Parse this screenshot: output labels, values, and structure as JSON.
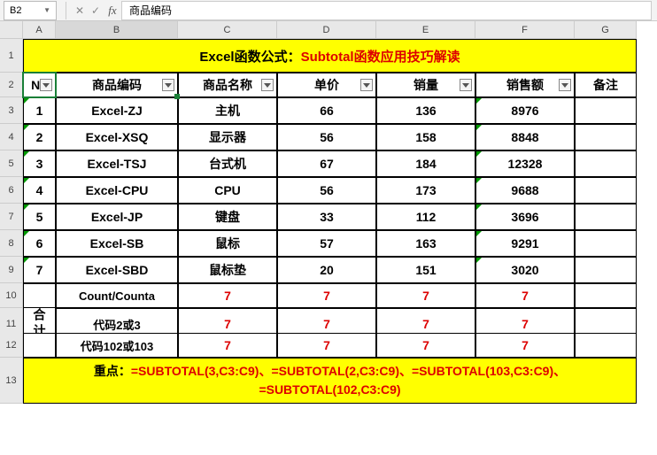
{
  "nameBox": "B2",
  "formulaContent": "商品编码",
  "colHeaders": [
    "A",
    "B",
    "C",
    "D",
    "E",
    "F",
    "G"
  ],
  "rowHeaders": [
    "1",
    "2",
    "3",
    "4",
    "5",
    "6",
    "7",
    "8",
    "9",
    "10",
    "11",
    "12",
    "13"
  ],
  "title": {
    "black": "Excel函数公式：",
    "red": "Subtotal函数应用技巧解读"
  },
  "headers": {
    "no": "No",
    "b": "商品编码",
    "c": "商品名称",
    "d": "单价",
    "e": "销量",
    "f": "销售额",
    "g": "备注"
  },
  "rows": [
    {
      "no": "1",
      "b": "Excel-ZJ",
      "c": "主机",
      "d": "66",
      "e": "136",
      "f": "8976"
    },
    {
      "no": "2",
      "b": "Excel-XSQ",
      "c": "显示器",
      "d": "56",
      "e": "158",
      "f": "8848"
    },
    {
      "no": "3",
      "b": "Excel-TSJ",
      "c": "台式机",
      "d": "67",
      "e": "184",
      "f": "12328"
    },
    {
      "no": "4",
      "b": "Excel-CPU",
      "c": "CPU",
      "d": "56",
      "e": "173",
      "f": "9688"
    },
    {
      "no": "5",
      "b": "Excel-JP",
      "c": "键盘",
      "d": "33",
      "e": "112",
      "f": "3696"
    },
    {
      "no": "6",
      "b": "Excel-SB",
      "c": "鼠标",
      "d": "57",
      "e": "163",
      "f": "9291"
    },
    {
      "no": "7",
      "b": "Excel-SBD",
      "c": "鼠标垫",
      "d": "20",
      "e": "151",
      "f": "3020"
    }
  ],
  "summary": {
    "mergeLabel": "合计",
    "rows": [
      {
        "b": "Count/Counta",
        "c": "7",
        "d": "7",
        "e": "7",
        "f": "7"
      },
      {
        "b": "代码2或3",
        "c": "7",
        "d": "7",
        "e": "7",
        "f": "7"
      },
      {
        "b": "代码102或103",
        "c": "7",
        "d": "7",
        "e": "7",
        "f": "7"
      }
    ]
  },
  "footer": {
    "label": "重点：",
    "f1": "=SUBTOTAL(3,C3:C9)",
    "s": "、",
    "f2": "=SUBTOTAL(2,C3:C9)",
    "f3": "=SUBTOTAL(103,C3:C9)",
    "f4": "=SUBTOTAL(102,C3:C9)"
  },
  "chart_data": {
    "type": "table",
    "title": "Excel函数公式：Subtotal函数应用技巧解读",
    "columns": [
      "No",
      "商品编码",
      "商品名称",
      "单价",
      "销量",
      "销售额",
      "备注"
    ],
    "rows": [
      [
        1,
        "Excel-ZJ",
        "主机",
        66,
        136,
        8976,
        ""
      ],
      [
        2,
        "Excel-XSQ",
        "显示器",
        56,
        158,
        8848,
        ""
      ],
      [
        3,
        "Excel-TSJ",
        "台式机",
        67,
        184,
        12328,
        ""
      ],
      [
        4,
        "Excel-CPU",
        "CPU",
        56,
        173,
        9688,
        ""
      ],
      [
        5,
        "Excel-JP",
        "键盘",
        33,
        112,
        3696,
        ""
      ],
      [
        6,
        "Excel-SB",
        "鼠标",
        57,
        163,
        9291,
        ""
      ],
      [
        7,
        "Excel-SBD",
        "鼠标垫",
        20,
        151,
        3020,
        ""
      ]
    ],
    "summary": [
      [
        "合计",
        "Count/Counta",
        7,
        7,
        7,
        7,
        ""
      ],
      [
        "合计",
        "代码2或3",
        7,
        7,
        7,
        7,
        ""
      ],
      [
        "合计",
        "代码102或103",
        7,
        7,
        7,
        7,
        ""
      ]
    ],
    "formulas": [
      "=SUBTOTAL(3,C3:C9)",
      "=SUBTOTAL(2,C3:C9)",
      "=SUBTOTAL(103,C3:C9)",
      "=SUBTOTAL(102,C3:C9)"
    ]
  }
}
